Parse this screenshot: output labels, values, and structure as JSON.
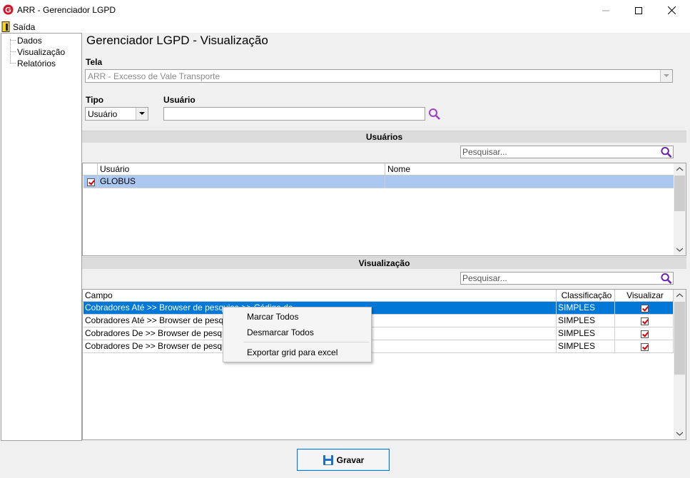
{
  "window": {
    "title": "ARR - Gerenciador LGPD",
    "minimize_icon": "minimize-icon",
    "maximize_icon": "maximize-icon",
    "close_icon": "close-icon"
  },
  "menu": {
    "saida_label": "Saída"
  },
  "nav": {
    "items": [
      {
        "label": "Dados"
      },
      {
        "label": "Visualização"
      },
      {
        "label": "Relatórios"
      }
    ]
  },
  "page_title": "Gerenciador LGPD - Visualização",
  "tela": {
    "label": "Tela",
    "value": "ARR - Excesso de Vale Transporte"
  },
  "tipo": {
    "label": "Tipo",
    "value": "Usuário"
  },
  "usuario": {
    "label": "Usuário",
    "value": ""
  },
  "usuarios_section": {
    "header": "Usuários",
    "search_placeholder": "Pesquisar...",
    "columns": [
      "Usuário",
      "Nome"
    ],
    "rows": [
      {
        "checked": true,
        "usuario": "GLOBUS",
        "nome": ""
      }
    ]
  },
  "visualizacao_section": {
    "header": "Visualização",
    "search_placeholder": "Pesquisar...",
    "columns": [
      "Campo",
      "Classificação",
      "Visualizar"
    ],
    "rows": [
      {
        "campo": "Cobradores Até >> Browser de pesquisa >> Código da",
        "classificacao": "SIMPLES",
        "visualizar": true
      },
      {
        "campo": "Cobradores Até >> Browser de pesquisa",
        "classificacao": "SIMPLES",
        "visualizar": true
      },
      {
        "campo": "Cobradores De >> Browser de pesquisa >",
        "classificacao": "SIMPLES",
        "visualizar": true
      },
      {
        "campo": "Cobradores De >> Browser de pesquisa >",
        "classificacao": "SIMPLES",
        "visualizar": true
      }
    ]
  },
  "context_menu": {
    "items": [
      {
        "label": "Marcar Todos"
      },
      {
        "label": "Desmarcar Todos"
      },
      {
        "label": "Exportar grid para excel"
      }
    ]
  },
  "footer": {
    "gravar_label": "Gravar"
  },
  "colors": {
    "selection": "#0078d7",
    "row_highlight": "#aac8f0",
    "search_icon": "#9b3fc6"
  }
}
